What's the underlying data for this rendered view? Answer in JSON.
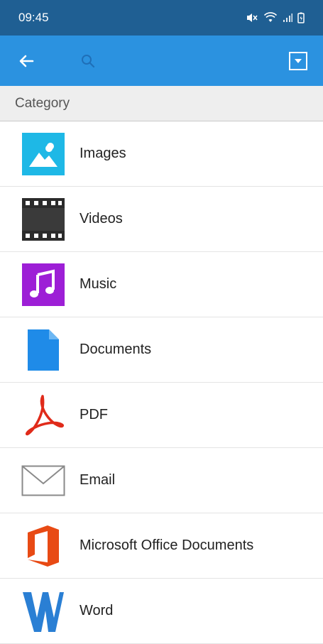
{
  "status_bar": {
    "time": "09:45",
    "icons": [
      "mute-icon",
      "wifi-icon",
      "signal-icon",
      "battery-icon"
    ]
  },
  "app_bar": {
    "back_icon": "arrow-left-icon",
    "search_icon": "search-icon",
    "search_value": "",
    "menu_icon": "dropdown-icon",
    "color": "#2b92e0"
  },
  "section": {
    "title": "Category"
  },
  "categories": [
    {
      "label": "Images",
      "icon": "image-icon",
      "color": "#1eb8e6"
    },
    {
      "label": "Videos",
      "icon": "film-icon",
      "color": "#333333"
    },
    {
      "label": "Music",
      "icon": "music-note-icon",
      "color": "#9d1fd6"
    },
    {
      "label": "Documents",
      "icon": "document-icon",
      "color": "#1f8be8"
    },
    {
      "label": "PDF",
      "icon": "pdf-icon",
      "color": "#e02b1a"
    },
    {
      "label": "Email",
      "icon": "envelope-icon",
      "color": "#8a8a8a"
    },
    {
      "label": "Microsoft Office Documents",
      "icon": "office-icon",
      "color": "#e84a14"
    },
    {
      "label": "Word",
      "icon": "word-icon",
      "color": "#2a7fd4"
    }
  ]
}
